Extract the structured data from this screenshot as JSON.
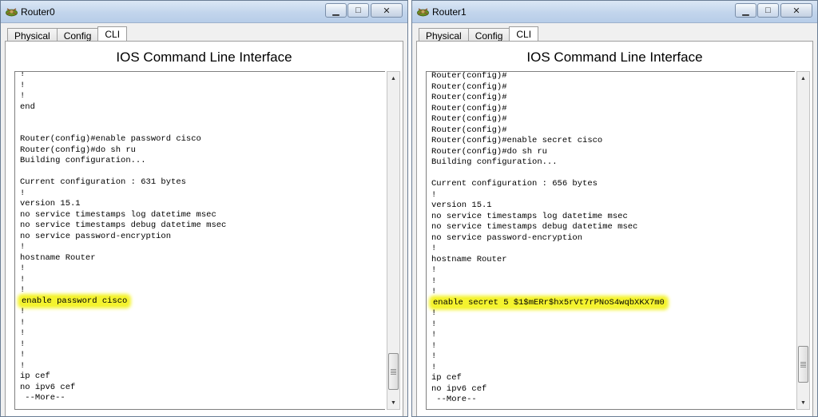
{
  "windows": [
    {
      "title": "Router0",
      "controls": {
        "minimize": "▁",
        "maximize": "□",
        "close": "✕"
      },
      "tabs": [
        {
          "label": "Physical",
          "active": false
        },
        {
          "label": "Config",
          "active": false
        },
        {
          "label": "CLI",
          "active": true
        }
      ],
      "panel_title": "IOS Command Line Interface",
      "console_lines": [
        "!",
        "!",
        "!",
        "end",
        "",
        "",
        "Router(config)#enable password cisco",
        "Router(config)#do sh ru",
        "Building configuration...",
        "",
        "Current configuration : 631 bytes",
        "!",
        "version 15.1",
        "no service timestamps log datetime msec",
        "no service timestamps debug datetime msec",
        "no service password-encryption",
        "!",
        "hostname Router",
        "!",
        "!",
        "!",
        "enable password cisco",
        "!",
        "!",
        "!",
        "!",
        "!",
        "!",
        "ip cef",
        "no ipv6 cef",
        " --More--"
      ],
      "highlighted_line": 21
    },
    {
      "title": "Router1",
      "controls": {
        "minimize": "▁",
        "maximize": "□",
        "close": "✕"
      },
      "tabs": [
        {
          "label": "Physical",
          "active": false
        },
        {
          "label": "Config",
          "active": false
        },
        {
          "label": "CLI",
          "active": true
        }
      ],
      "panel_title": "IOS Command Line Interface",
      "console_lines": [
        "Router(config)#",
        "Router(config)#",
        "Router(config)#",
        "Router(config)#",
        "Router(config)#",
        "Router(config)#",
        "Router(config)#enable secret cisco",
        "Router(config)#do sh ru",
        "Building configuration...",
        "",
        "Current configuration : 656 bytes",
        "!",
        "version 15.1",
        "no service timestamps log datetime msec",
        "no service timestamps debug datetime msec",
        "no service password-encryption",
        "!",
        "hostname Router",
        "!",
        "!",
        "!",
        "enable secret 5 $1$mERr$hx5rVt7rPNoS4wqbXKX7m0",
        "!",
        "!",
        "!",
        "!",
        "!",
        "!",
        "ip cef",
        "no ipv6 cef",
        " --More--"
      ],
      "highlighted_line": 21
    }
  ],
  "colors": {
    "highlight": "#f4f32e",
    "titlebar": "#c2d5ec"
  }
}
